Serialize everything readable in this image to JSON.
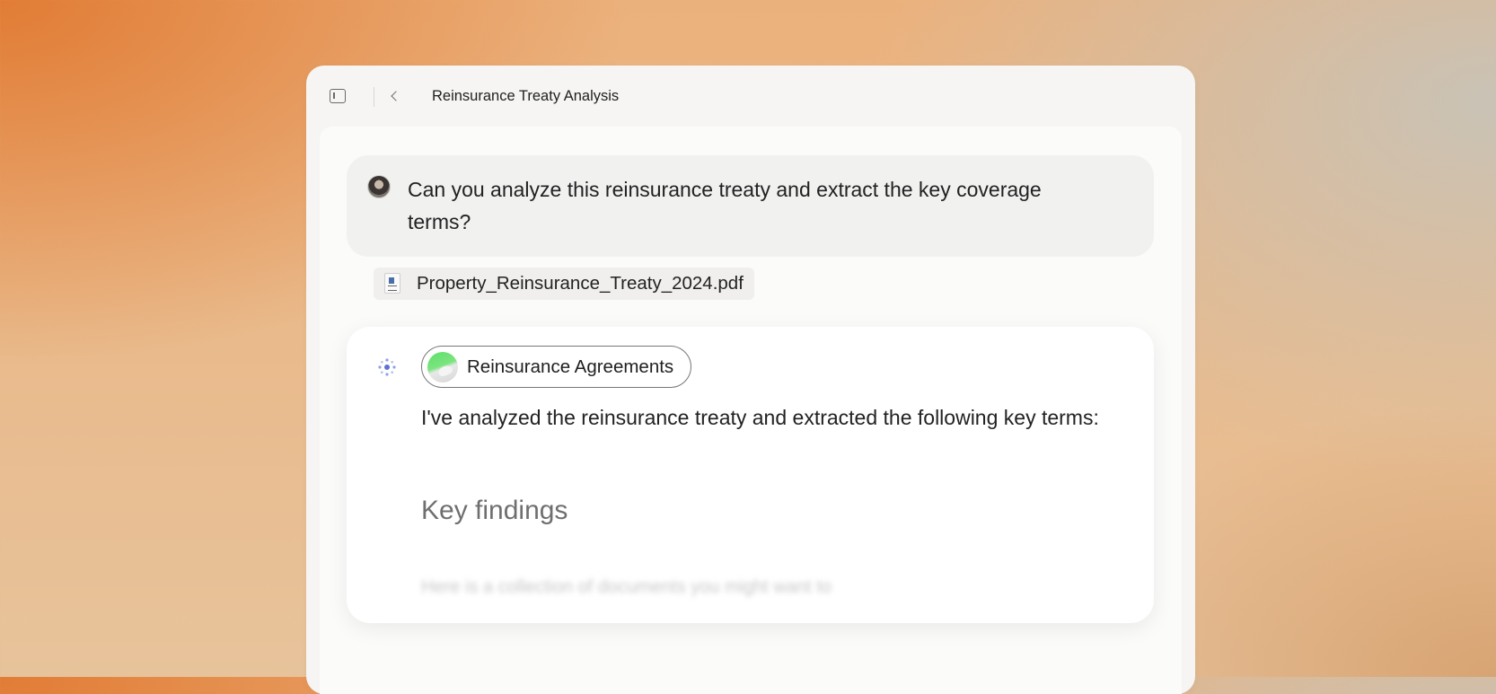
{
  "window": {
    "title": "Reinsurance Treaty Analysis"
  },
  "icons": {
    "sidebar": "sidebar-toggle-icon",
    "back": "chevron-left-icon",
    "user_avatar": "user-avatar",
    "attachment": "pdf-file-icon",
    "assistant": "assistant-spark-icon",
    "agent_badge": "agent-badge-icon"
  },
  "user_message": {
    "text": "Can you analyze this reinsurance treaty and extract the key coverage terms?"
  },
  "attachment": {
    "filename": "Property_Reinsurance_Treaty_2024.pdf"
  },
  "assistant_message": {
    "agent_label": "Reinsurance Agreements",
    "text": "I've analyzed the reinsurance treaty and extracted the following key terms:",
    "heading": "Key findings",
    "faded_text": "Here is a collection of documents you might want to"
  },
  "colors": {
    "accent_spark": "#6b7fd7",
    "agent_badge": "#5fe06a",
    "window_bg": "#f6f5f3"
  }
}
